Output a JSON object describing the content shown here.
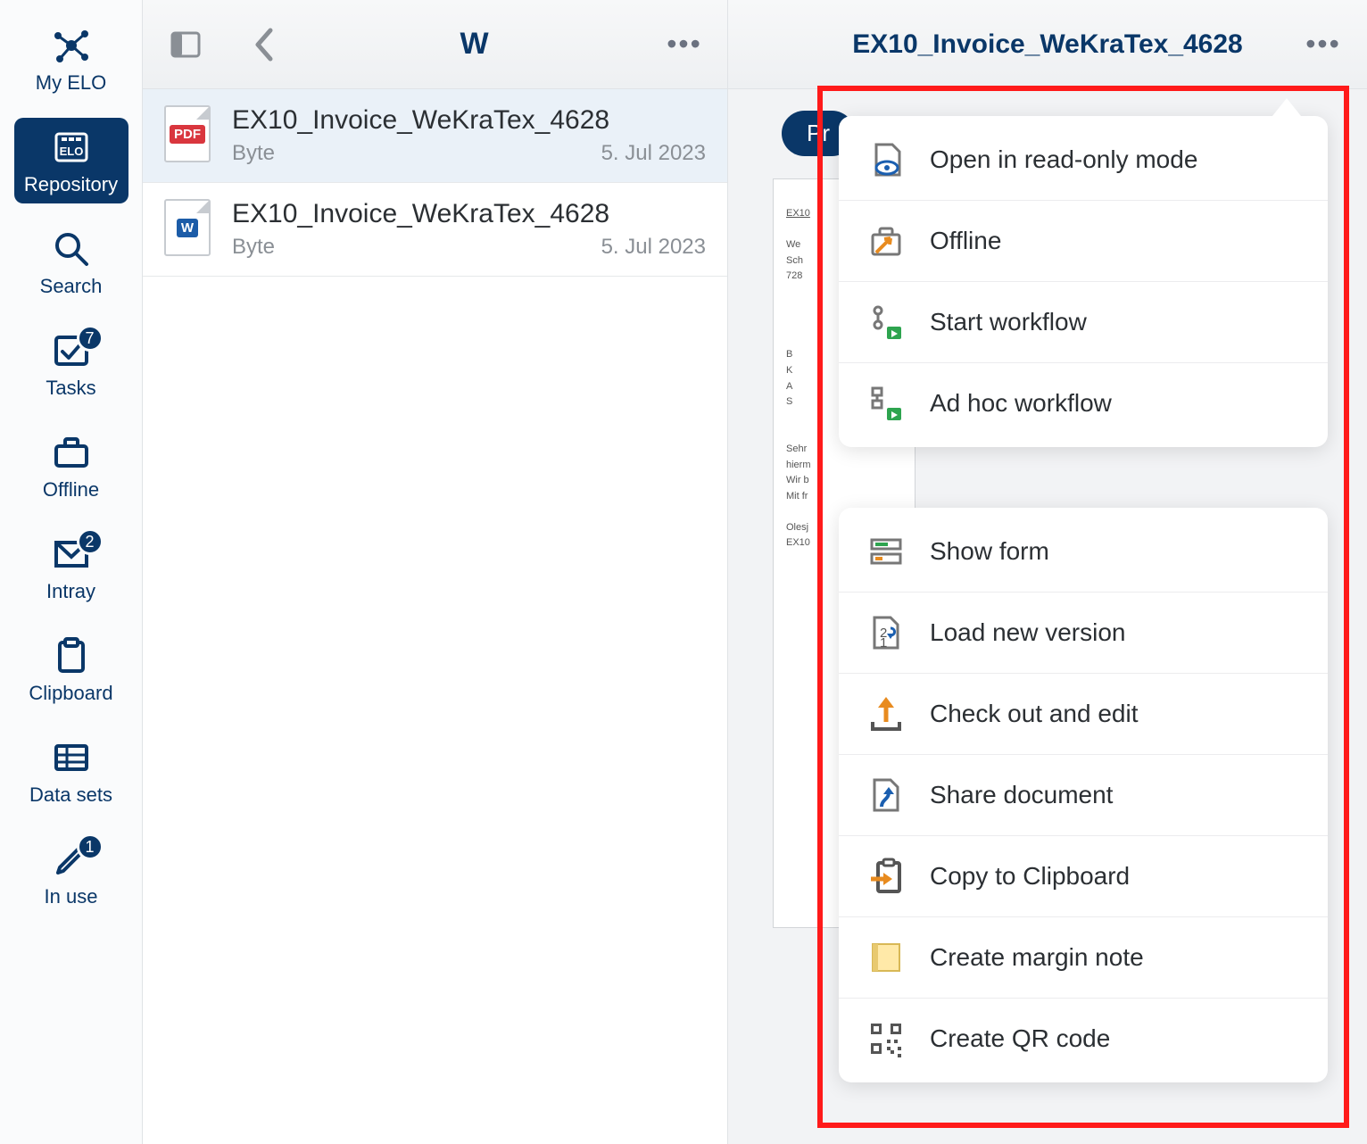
{
  "rail": {
    "items": [
      {
        "id": "myelo",
        "label": "My ELO"
      },
      {
        "id": "repository",
        "label": "Repository"
      },
      {
        "id": "search",
        "label": "Search"
      },
      {
        "id": "tasks",
        "label": "Tasks",
        "badge": "7"
      },
      {
        "id": "offline",
        "label": "Offline"
      },
      {
        "id": "intray",
        "label": "Intray",
        "badge": "2"
      },
      {
        "id": "clipboard",
        "label": "Clipboard"
      },
      {
        "id": "datasets",
        "label": "Data sets"
      },
      {
        "id": "inuse",
        "label": "In use",
        "badge": "1"
      }
    ]
  },
  "list": {
    "header_title": "W",
    "rows": [
      {
        "title": "EX10_Invoice_WeKraTex_4628",
        "meta_left": "Byte",
        "meta_right": "5. Jul 2023",
        "type": "pdf"
      },
      {
        "title": "EX10_Invoice_WeKraTex_4628",
        "meta_left": "Byte",
        "meta_right": "5. Jul 2023",
        "type": "w"
      }
    ]
  },
  "preview": {
    "title": "EX10_Invoice_WeKraTex_4628",
    "badge": "Pr"
  },
  "menu": {
    "group1": [
      {
        "id": "readonly",
        "label": "Open in read-only mode"
      },
      {
        "id": "offline",
        "label": "Offline"
      },
      {
        "id": "workflow",
        "label": "Start workflow"
      },
      {
        "id": "adhoc",
        "label": "Ad hoc workflow"
      }
    ],
    "group2": [
      {
        "id": "form",
        "label": "Show form"
      },
      {
        "id": "newver",
        "label": "Load new version"
      },
      {
        "id": "checkout",
        "label": "Check out and edit"
      },
      {
        "id": "share",
        "label": "Share document"
      },
      {
        "id": "copyclip",
        "label": "Copy to Clipboard"
      },
      {
        "id": "margin",
        "label": "Create margin note"
      },
      {
        "id": "qr",
        "label": "Create QR code"
      }
    ]
  }
}
